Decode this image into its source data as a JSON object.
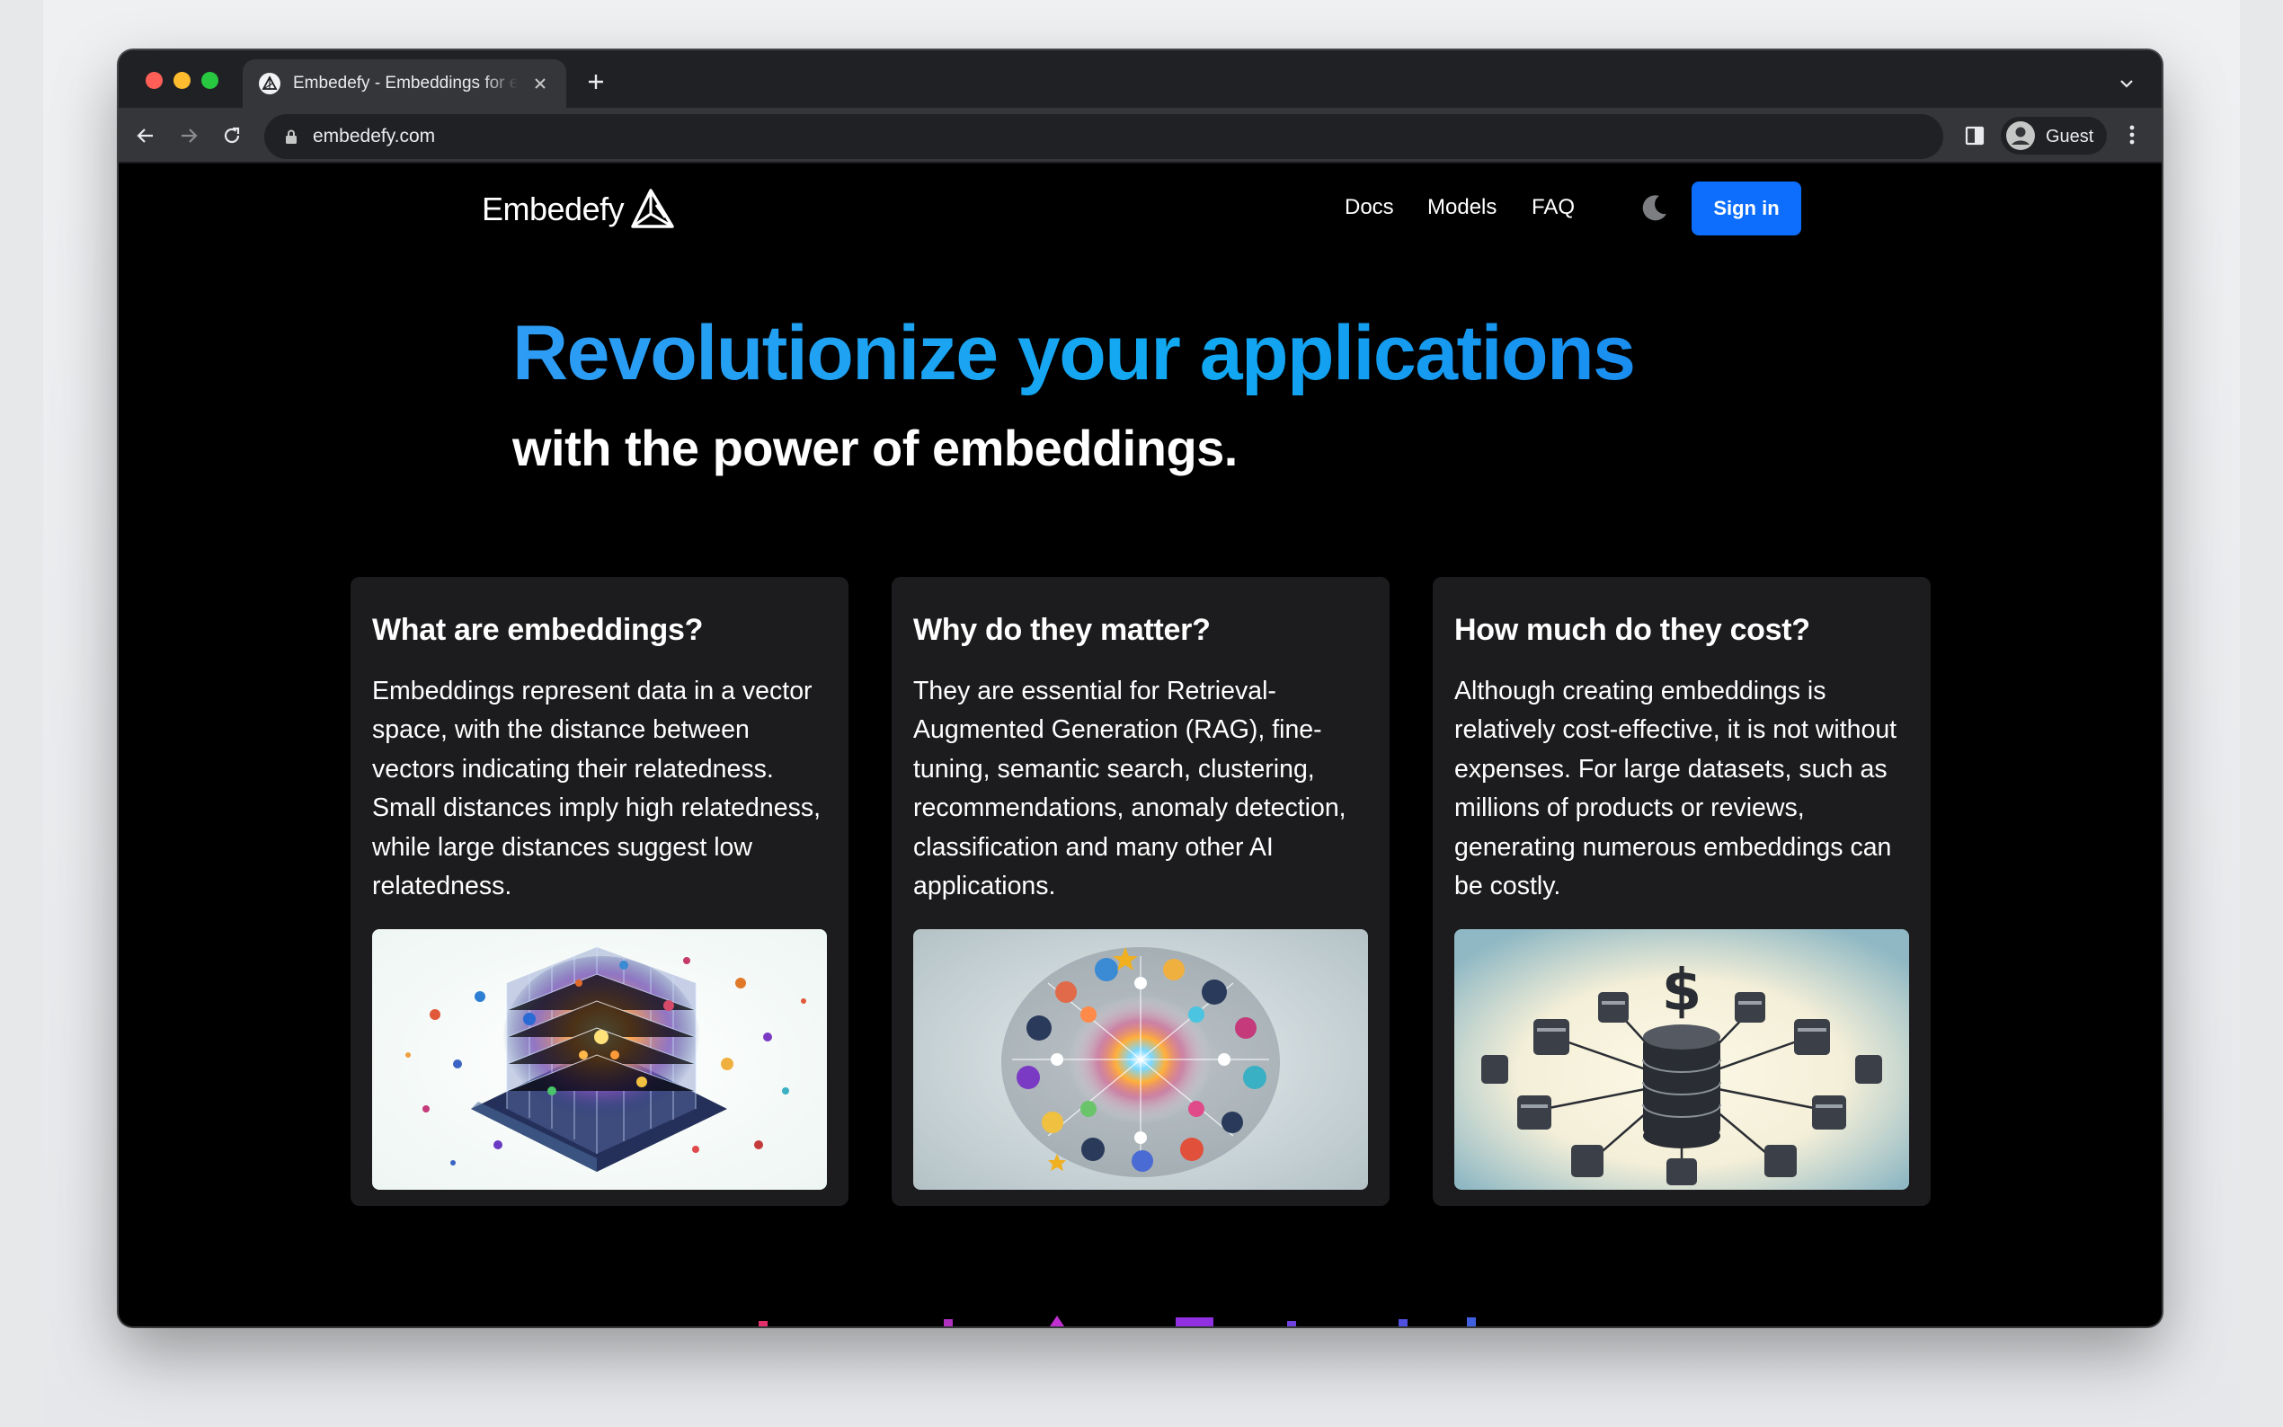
{
  "browser": {
    "tab_title": "Embedefy - Embeddings for everyone",
    "url": "embedefy.com",
    "profile_label": "Guest"
  },
  "site": {
    "brand": "Embedefy",
    "nav": [
      "Docs",
      "Models",
      "FAQ"
    ],
    "signin_label": "Sign in",
    "accent": "#0d6efd"
  },
  "hero": {
    "title": "Revolutionize your applications",
    "subtitle": "with the power of embeddings."
  },
  "cards": [
    {
      "title": "What are embeddings?",
      "body": "Embeddings represent data in a vector space, with the distance between vectors indicating their relatedness. Small distances imply high relatedness, while large distances suggest low relatedness."
    },
    {
      "title": "Why do they matter?",
      "body": "They are essential for Retrieval-Augmented Generation (RAG), fine-tuning, semantic search, clustering, recommendations, anomaly detection, classification and many other AI applications."
    },
    {
      "title": "How much do they cost?",
      "body": "Although creating embeddings is relatively cost-effective, it is not without expenses. For large datasets, such as millions of products or reviews, generating numerous embeddings can be costly."
    }
  ]
}
